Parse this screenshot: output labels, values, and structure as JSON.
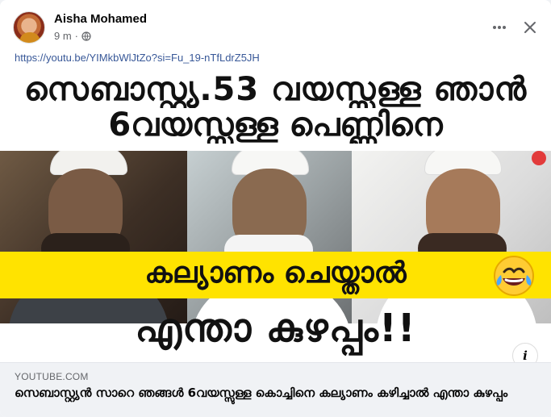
{
  "post": {
    "author": "Aisha Mohamed",
    "time": "9 m",
    "link_url": "https://youtu.be/YIMkbWlJtZo?si=Fu_19-nTfLdrZ5JH"
  },
  "thumbnail": {
    "line1": "സെബാസ്റ്റ്യ.53 വയസ്സുള്ള ഞാൻ",
    "line2": "6വയസ്സുള്ള പെണ്ണിനെ",
    "line3": "കല്യാണം ചെയ്താൽ",
    "line4": "എന്താ കുഴപ്പം!!"
  },
  "link_preview": {
    "domain": "YOUTUBE.COM",
    "title": "സെബാസ്റ്റ്യൻ സാറെ ഞങ്ങൾ 6വയസ്സുള്ള കൊച്ചിനെ കല്യാണം കഴിച്ചാൽ എന്താ കുഴപ്പം"
  },
  "icons": {
    "more": "more-horizontal-icon",
    "close": "close-icon",
    "privacy": "globe-icon",
    "info": "info-icon",
    "emoji": "laughing-emoji-icon"
  },
  "colors": {
    "link": "#385898",
    "secondary_text": "#65676b",
    "yellow_band": "#ffe300"
  }
}
